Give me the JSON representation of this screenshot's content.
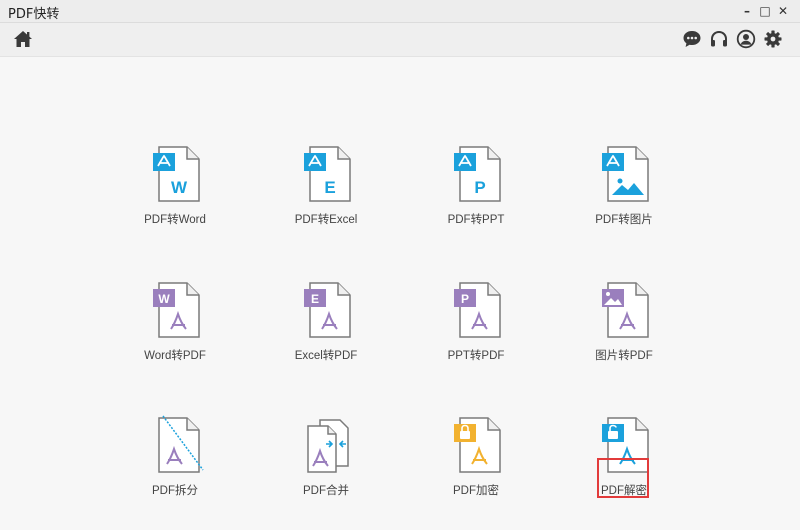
{
  "window": {
    "title": "PDF快转",
    "minimize_glyph": "–",
    "maximize_glyph": "□",
    "close_glyph": "✕"
  },
  "toolbar": {
    "home_icon": "home-icon",
    "actions": [
      "chat-icon",
      "headset-icon",
      "user-icon",
      "gear-icon"
    ]
  },
  "colors": {
    "blue_badge": "#1ba1dc",
    "purple_badge": "#9a7fbd",
    "orange_badge": "#f2b230",
    "acrobat_blue": "#1ba1dc",
    "acrobat_purple": "#9a7fbd",
    "acrobat_orange": "#f2b230",
    "highlight": "#e23b3b"
  },
  "tiles": [
    {
      "label": "PDF转Word",
      "badge_text": "",
      "letter": "W"
    },
    {
      "label": "PDF转Excel",
      "badge_text": "",
      "letter": "E"
    },
    {
      "label": "PDF转PPT",
      "badge_text": "",
      "letter": "P"
    },
    {
      "label": "PDF转图片",
      "badge_text": "",
      "letter": ""
    },
    {
      "label": "Word转PDF",
      "badge_text": "W",
      "letter": ""
    },
    {
      "label": "Excel转PDF",
      "badge_text": "E",
      "letter": ""
    },
    {
      "label": "PPT转PDF",
      "badge_text": "P",
      "letter": ""
    },
    {
      "label": "图片转PDF",
      "badge_text": "",
      "letter": ""
    },
    {
      "label": "PDF拆分",
      "badge_text": "",
      "letter": ""
    },
    {
      "label": "PDF合并",
      "badge_text": "",
      "letter": ""
    },
    {
      "label": "PDF加密",
      "badge_text": "",
      "letter": ""
    },
    {
      "label": "PDF解密",
      "badge_text": "",
      "letter": ""
    }
  ]
}
